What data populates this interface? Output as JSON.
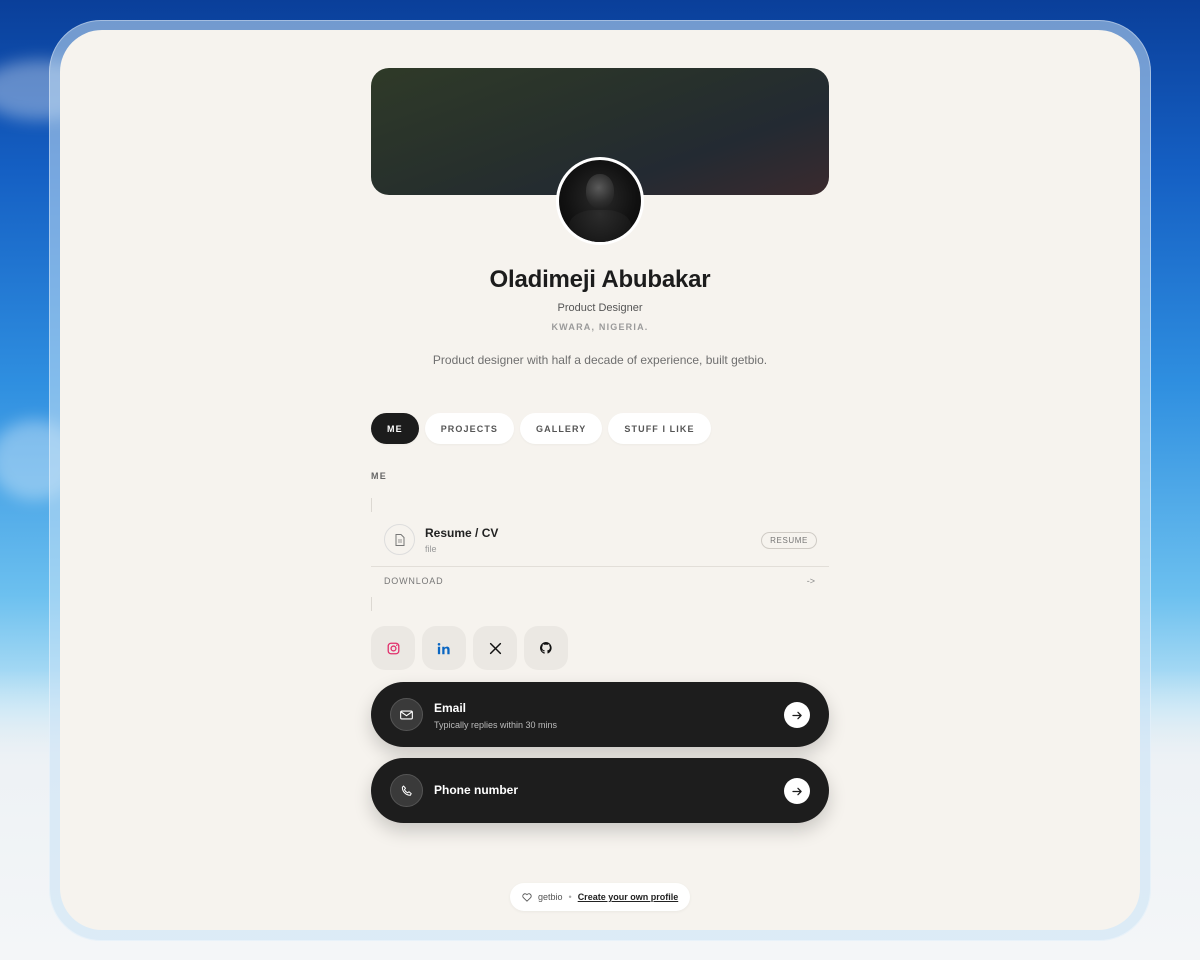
{
  "profile": {
    "name": "Oladimeji Abubakar",
    "role": "Product Designer",
    "location": "KWARA, NIGERIA.",
    "bio": "Product designer with half a decade of experience, built getbio."
  },
  "tabs": [
    {
      "label": "ME",
      "active": true
    },
    {
      "label": "PROJECTS",
      "active": false
    },
    {
      "label": "GALLERY",
      "active": false
    },
    {
      "label": "STUFF I LIKE",
      "active": false
    }
  ],
  "section": {
    "label": "ME",
    "resume": {
      "title": "Resume / CV",
      "subtitle": "file",
      "badge": "RESUME",
      "action": "DOWNLOAD",
      "action_arrow": "->"
    }
  },
  "socials": [
    {
      "icon": "instagram-icon",
      "color": "#e1306c"
    },
    {
      "icon": "linkedin-icon",
      "color": "#0a66c2"
    },
    {
      "icon": "x-icon",
      "color": "#111111"
    },
    {
      "icon": "github-icon",
      "color": "#111111"
    }
  ],
  "contacts": {
    "email": {
      "title": "Email",
      "subtitle": "Typically replies within 30 mins",
      "icon": "mail-icon"
    },
    "phone": {
      "title": "Phone number",
      "icon": "phone-icon"
    }
  },
  "footer": {
    "brand": "getbio",
    "separator": "•",
    "link": "Create your own profile"
  },
  "colors": {
    "accent_dark": "#1c1c1c",
    "panel_bg": "#f6f3ee"
  }
}
